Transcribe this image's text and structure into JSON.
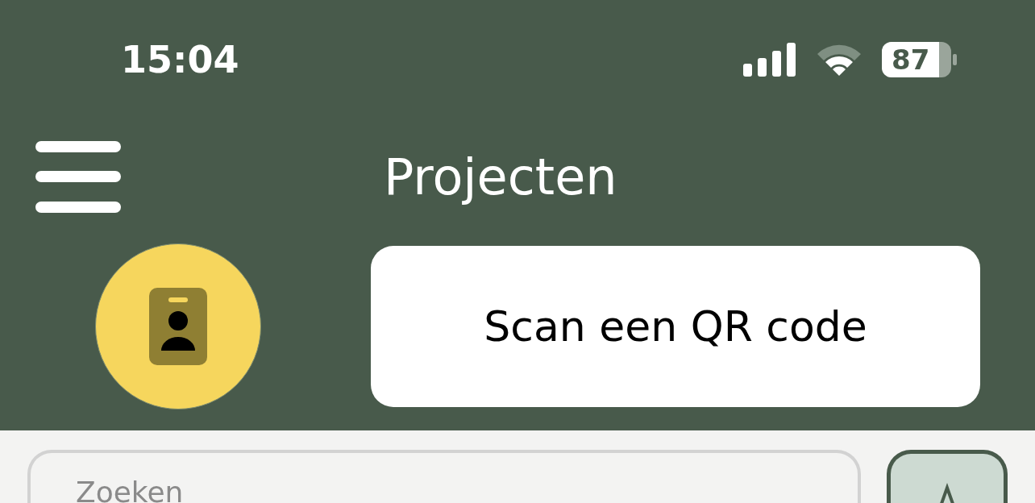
{
  "status_bar": {
    "time": "15:04",
    "battery": "87"
  },
  "header": {
    "title": "Projecten",
    "scan_button": "Scan een QR code"
  },
  "search": {
    "placeholder": "Zoeken"
  }
}
